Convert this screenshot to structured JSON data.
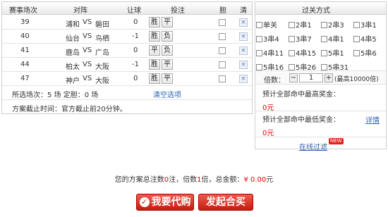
{
  "columns": {
    "match_no": "赛事场次",
    "teams": "对阵",
    "handicap": "让球",
    "bet": "投注",
    "banker": "胆",
    "clear": "清"
  },
  "matches": [
    {
      "no": "39",
      "home": "浦和",
      "away": "磐田",
      "handicap": "0",
      "pick1": "胜",
      "pick2": "平"
    },
    {
      "no": "40",
      "home": "仙台",
      "away": "鸟栖",
      "handicap": "-1",
      "pick1": "胜",
      "pick2": "负"
    },
    {
      "no": "41",
      "home": "鹿岛",
      "away": "广岛",
      "handicap": "0",
      "pick1": "平",
      "pick2": "负"
    },
    {
      "no": "44",
      "home": "柏太",
      "away": "大阪",
      "handicap": "-1",
      "pick1": "胜",
      "pick2": "平"
    },
    {
      "no": "47",
      "home": "神户",
      "away": "大阪",
      "handicap": "0",
      "pick1": "胜",
      "pick2": "平"
    }
  ],
  "vs": "VS",
  "clear_symbol": "×",
  "summary": {
    "selected": "所选场次：5 场 定胆：0 场",
    "clear_link": "清空选项",
    "deadline": "方案截止时间：官方截止前20分钟。"
  },
  "pass": {
    "title": "过关方式",
    "options": [
      "单关",
      "2串1",
      "2串3",
      "3串1",
      "3串4",
      "3串7",
      "4串1",
      "4串5",
      "4串11",
      "4串15",
      "5串1",
      "5串6",
      "5串16",
      "5串26",
      "5串31"
    ],
    "multiple_label": "倍数：",
    "minus": "−",
    "plus": "+",
    "multiple_value": "1",
    "multiple_max": "(最高10000倍)",
    "max_prize_label": "预计全部命中最高奖金：",
    "max_prize": "0元",
    "min_prize_label": "预计全部命中最低奖金：",
    "min_prize": "0元",
    "detail_link": "详情",
    "filter_link": "在线过滤",
    "new_badge": "NEW"
  },
  "footer": {
    "t1": "您的方案总注数",
    "bets": "0",
    "t2": "注，倍数",
    "multiple": "1",
    "t3": "倍，总金额：",
    "amount": "¥ 0.00",
    "t4": "元",
    "btn_buy": "我要代购",
    "btn_group": "发起合买"
  }
}
